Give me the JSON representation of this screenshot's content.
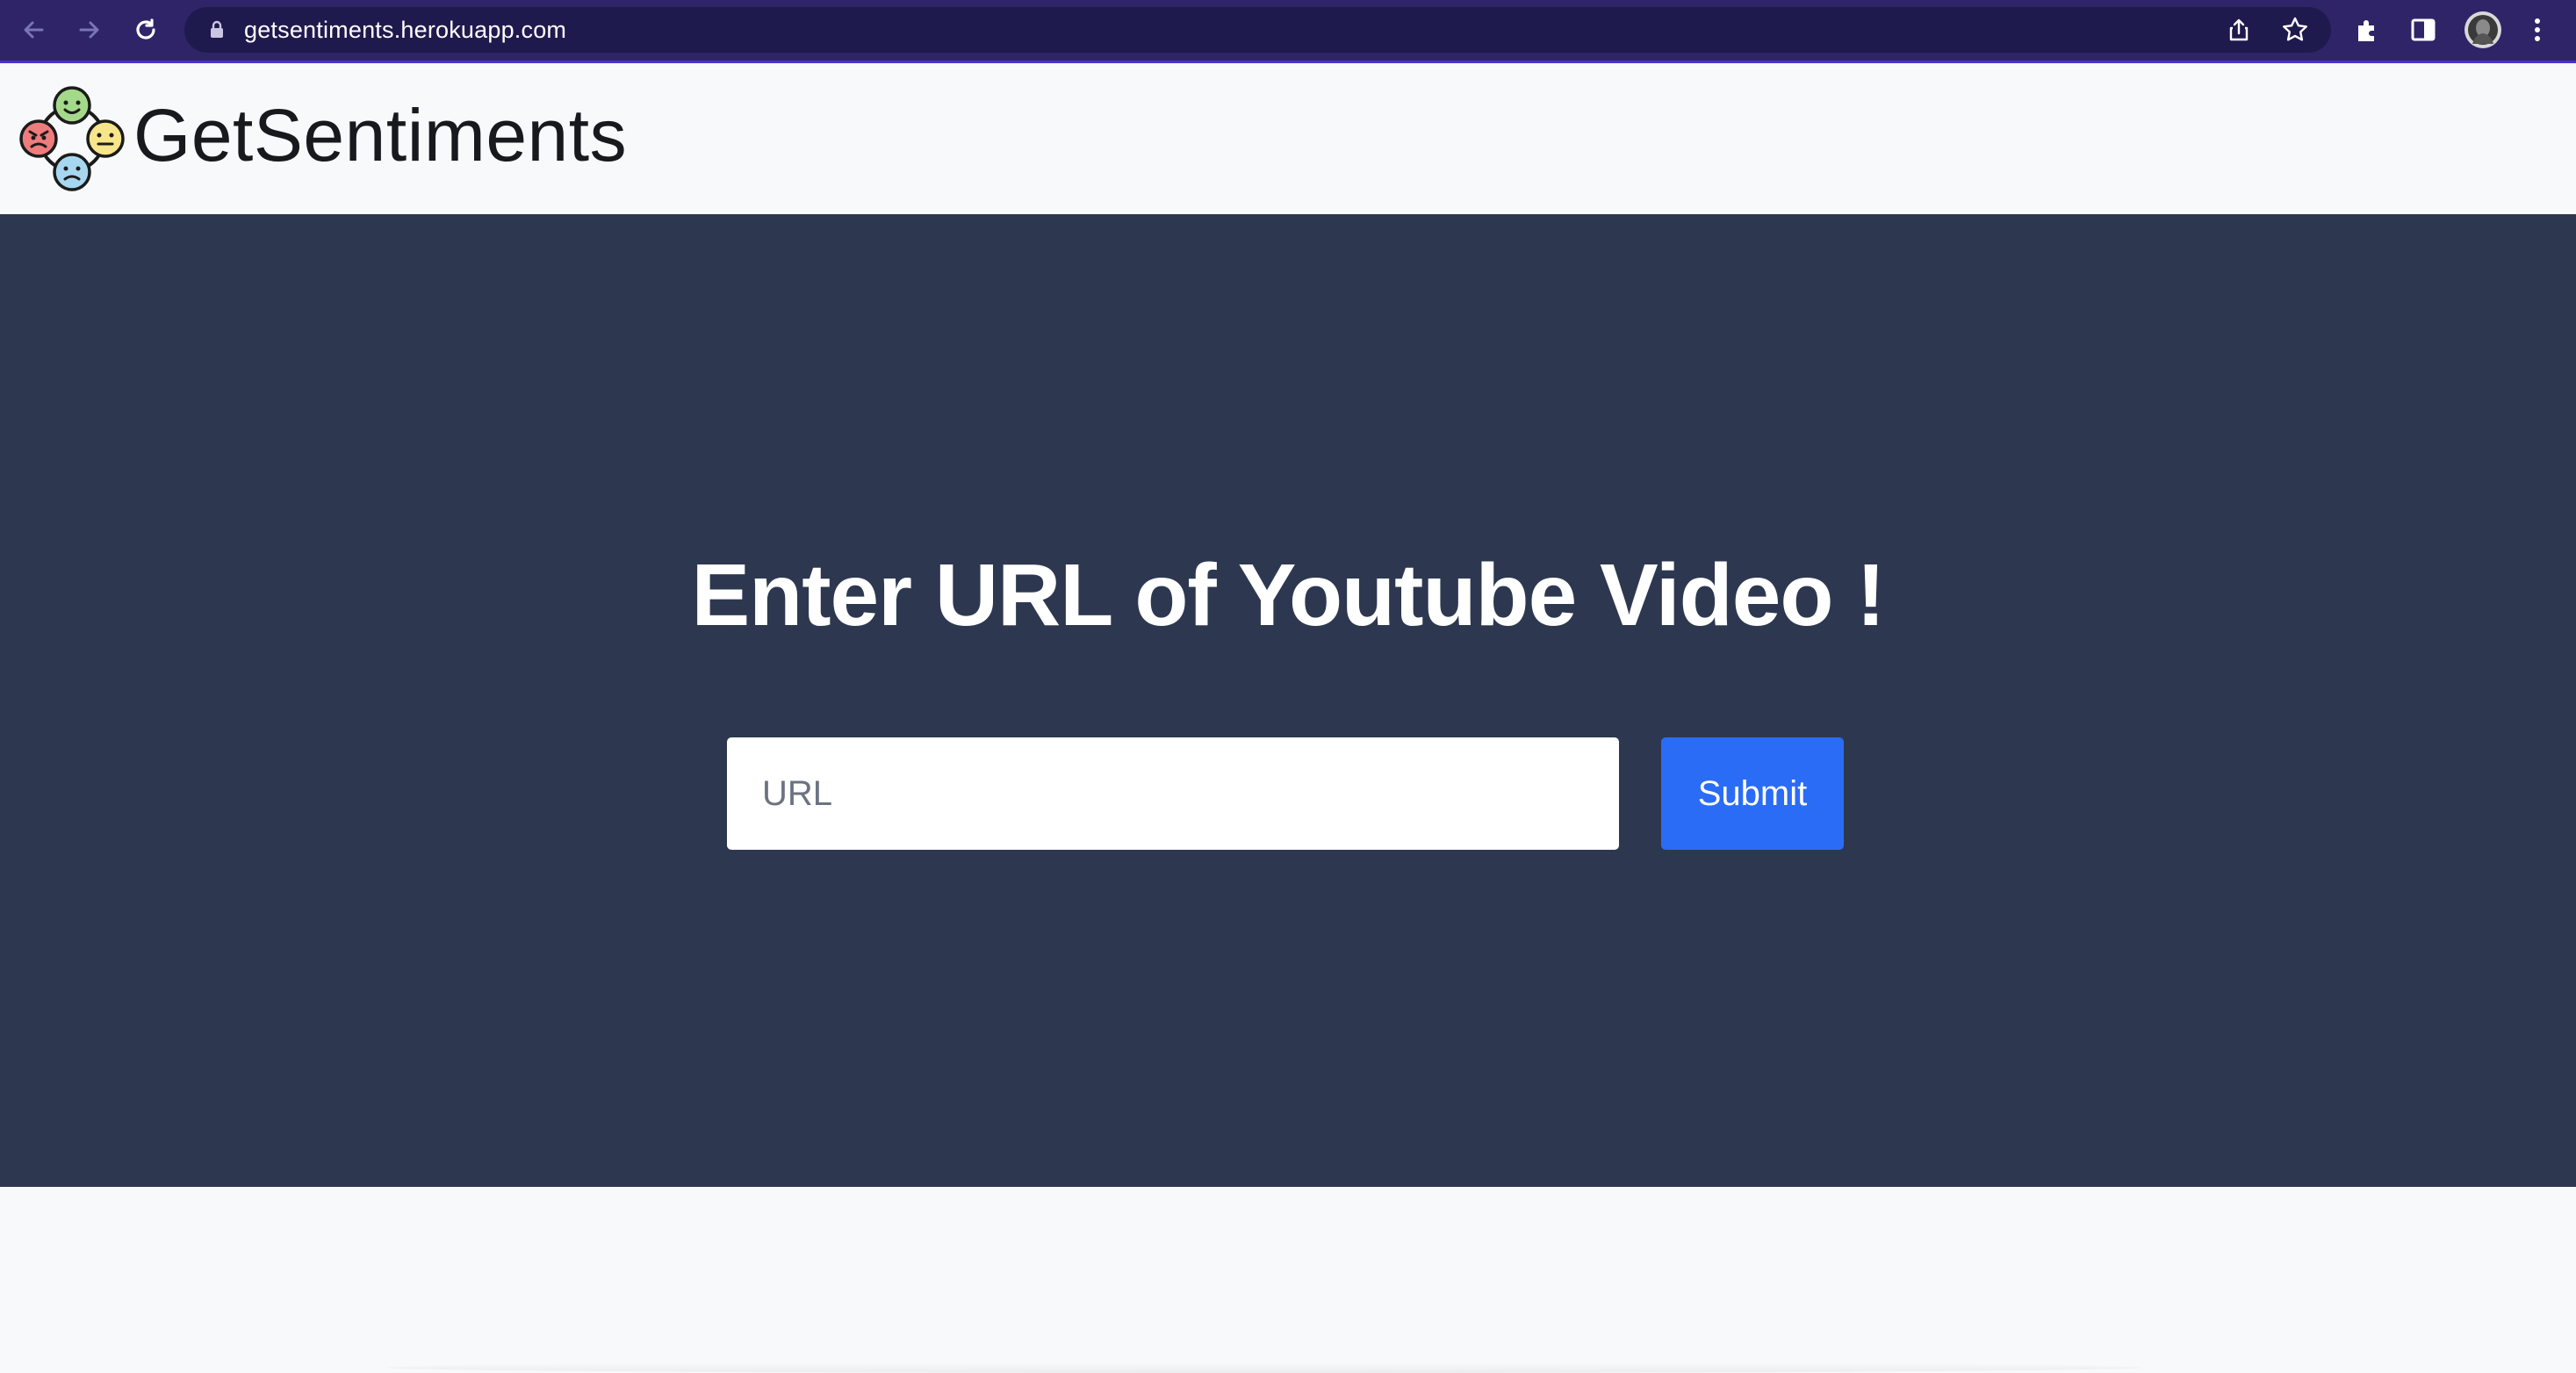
{
  "browser": {
    "address": "getsentiments.herokuapp.com",
    "icons": {
      "back": "back-arrow-icon",
      "forward": "forward-arrow-icon",
      "reload": "reload-icon",
      "lock": "lock-icon",
      "share": "share-icon",
      "bookmark": "star-icon",
      "extensions": "puzzle-icon",
      "side_panel": "side-panel-icon",
      "profile": "avatar",
      "menu": "kebab-menu-icon"
    }
  },
  "header": {
    "brand": "GetSentiments",
    "logo": "emoji-faces-logo"
  },
  "hero": {
    "title": "Enter URL of Youtube Video !",
    "input_placeholder": "URL",
    "input_value": "",
    "submit_label": "Submit"
  },
  "colors": {
    "chrome": "#2f2468",
    "hero_bg": "#2d3850",
    "accent": "#2b6cf6",
    "page_bg": "#f8f9fb"
  }
}
